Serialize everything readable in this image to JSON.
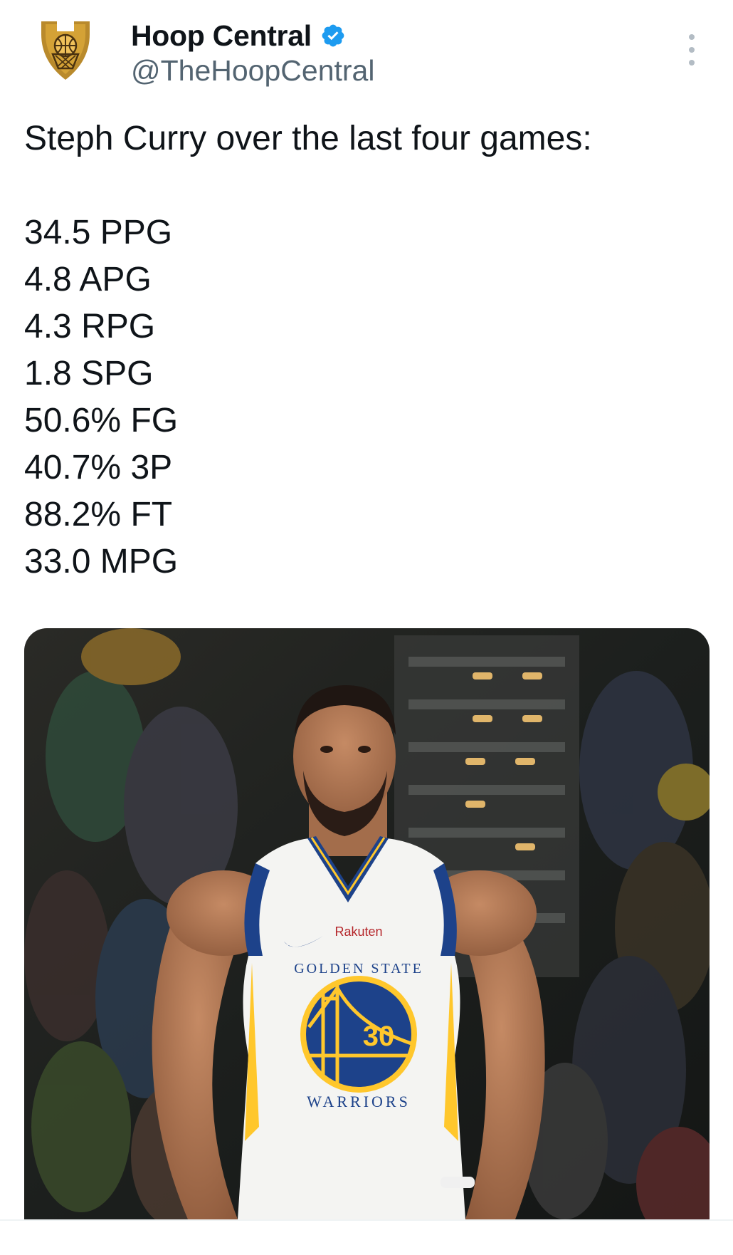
{
  "tweet": {
    "display_name": "Hoop Central",
    "handle": "@TheHoopCentral",
    "verified_icon": "verified-badge-icon",
    "more_icon": "more-options-icon",
    "text_intro": "Steph Curry over the last four games:",
    "stats": [
      "34.5 PPG",
      "4.8 APG",
      "4.3 RPG",
      "1.8 SPG",
      "50.6% FG",
      "40.7% 3P",
      "88.2% FT",
      "33.0 MPG"
    ],
    "media": {
      "jersey_sponsor": "Rakuten",
      "jersey_team_top": "GOLDEN STATE",
      "jersey_team_bottom": "WARRIORS",
      "jersey_number": "30"
    }
  },
  "colors": {
    "verified": "#1d9bf0",
    "warriors_blue": "#1d428a",
    "warriors_gold": "#ffc72c"
  }
}
